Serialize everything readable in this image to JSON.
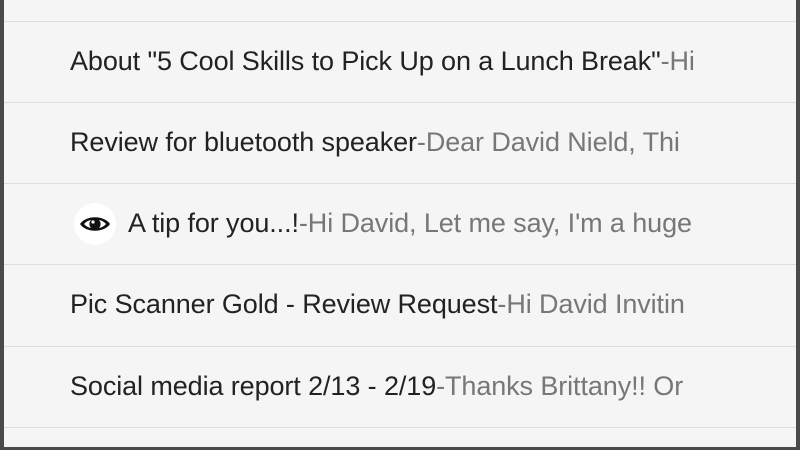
{
  "emails": [
    {
      "subject": "About \"5 Cool Skills to Pick Up on a Lunch Break\"",
      "separator": " - ",
      "snippet": "Hi",
      "has_icon": false
    },
    {
      "subject": "Review for bluetooth speaker",
      "separator": " - ",
      "snippet": "Dear David Nield, Thi",
      "has_icon": false
    },
    {
      "subject": "A tip for you...!",
      "separator": " - ",
      "snippet": "Hi David, Let me say, I'm a huge",
      "has_icon": true,
      "icon": "eye-icon"
    },
    {
      "subject": "Pic Scanner Gold - Review Request",
      "separator": " - ",
      "snippet": "Hi David Invitin",
      "has_icon": false
    },
    {
      "subject": "Social media report 2/13 - 2/19",
      "separator": " - ",
      "snippet": "Thanks Brittany!! Or",
      "has_icon": false
    }
  ],
  "colors": {
    "subject": "#222222",
    "snippet": "#777777",
    "row_background": "#f5f5f5",
    "divider": "#dedede",
    "frame": "#4a4a4a"
  }
}
